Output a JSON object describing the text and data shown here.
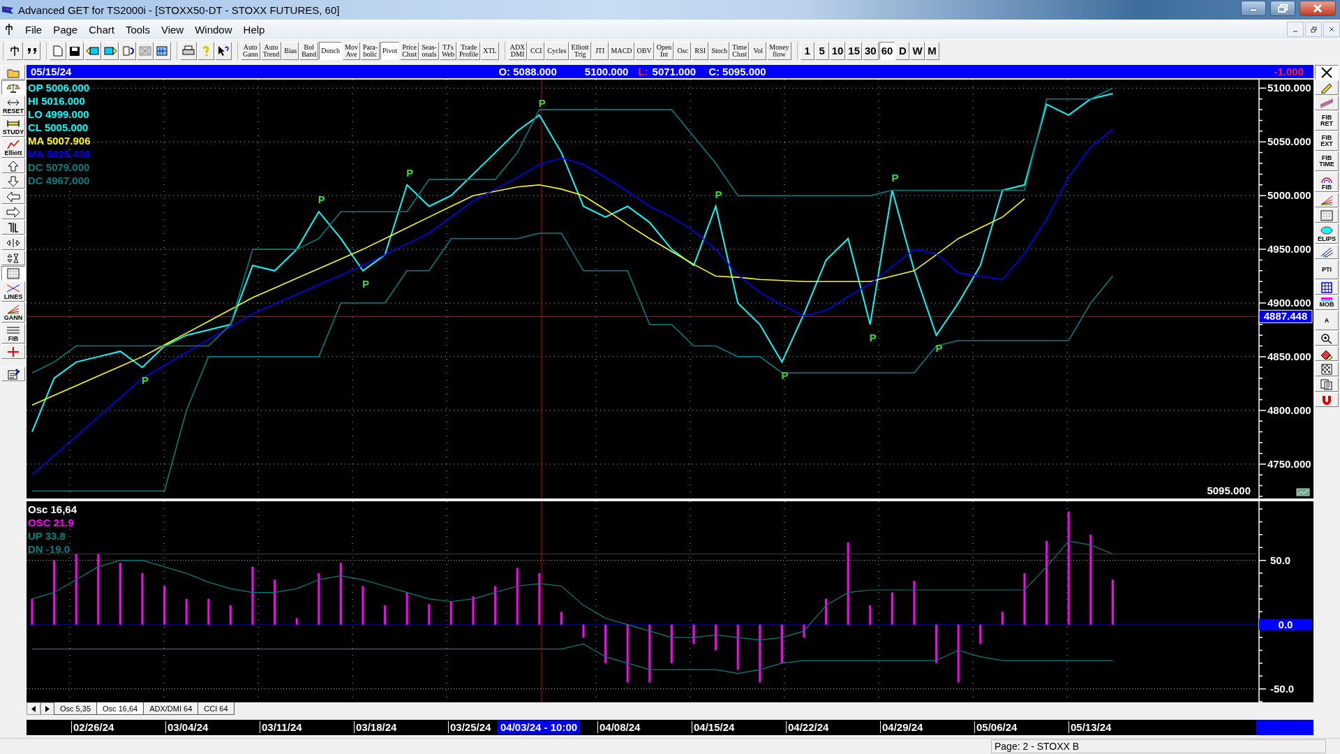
{
  "window": {
    "title": "Advanced GET for TS2000i - [STOXX50-DT - STOXX FUTURES, 60]"
  },
  "menu": [
    "File",
    "Page",
    "Chart",
    "Tools",
    "View",
    "Window",
    "Help"
  ],
  "toolbar": {
    "groups": [
      {
        "items": [
          {
            "kind": "icon",
            "selected": false
          },
          {
            "kind": "icon",
            "selected": false
          }
        ]
      },
      {
        "items": [
          {
            "kind": "icon",
            "selected": false
          },
          {
            "kind": "icon",
            "selected": false
          },
          {
            "kind": "icon",
            "selected": false
          },
          {
            "kind": "icon",
            "selected": false
          },
          {
            "kind": "icon",
            "selected": false
          },
          {
            "kind": "icon",
            "selected": false
          },
          {
            "kind": "icon",
            "selected": false
          }
        ]
      },
      {
        "items": [
          {
            "kind": "icon",
            "selected": false
          },
          {
            "kind": "icon",
            "selected": false
          },
          {
            "kind": "icon",
            "selected": false
          }
        ]
      },
      {
        "items": [
          {
            "kind": "text",
            "label": "Auto\nGann",
            "selected": false
          },
          {
            "kind": "text",
            "label": "Auto\nTrend",
            "selected": false
          },
          {
            "kind": "text",
            "label": "Bias",
            "selected": false
          },
          {
            "kind": "text",
            "label": "Bol\nBand",
            "selected": false
          },
          {
            "kind": "text",
            "label": "Donch",
            "selected": true
          },
          {
            "kind": "text",
            "label": "Mov\nAve",
            "selected": false
          },
          {
            "kind": "text",
            "label": "Para-\nbolic",
            "selected": false
          },
          {
            "kind": "text",
            "label": "Pivot",
            "selected": true
          },
          {
            "kind": "text",
            "label": "Price\nClust",
            "selected": false
          },
          {
            "kind": "text",
            "label": "Seas-\nonals",
            "selected": false
          },
          {
            "kind": "text",
            "label": "TJ's\nWeb",
            "selected": false
          },
          {
            "kind": "text",
            "label": "Trade\nProfile",
            "selected": false
          },
          {
            "kind": "text",
            "label": "XTL",
            "selected": false
          }
        ]
      },
      {
        "items": [
          {
            "kind": "text",
            "label": "ADX\nDMI",
            "selected": false
          },
          {
            "kind": "text",
            "label": "CCI",
            "selected": false
          },
          {
            "kind": "text",
            "label": "Cycles",
            "selected": false
          },
          {
            "kind": "text",
            "label": "Elliott\nTrig",
            "selected": false
          },
          {
            "kind": "text",
            "label": "JTI",
            "selected": false
          },
          {
            "kind": "text",
            "label": "MACD",
            "selected": false
          },
          {
            "kind": "text",
            "label": "OBV",
            "selected": false
          },
          {
            "kind": "text",
            "label": "Open\nInt",
            "selected": false
          },
          {
            "kind": "text",
            "label": "Osc",
            "selected": false
          },
          {
            "kind": "text",
            "label": "RSI",
            "selected": false
          },
          {
            "kind": "text",
            "label": "Stoch",
            "selected": false
          },
          {
            "kind": "text",
            "label": "Time\nClust",
            "selected": false
          },
          {
            "kind": "text",
            "label": "Vol",
            "selected": false
          },
          {
            "kind": "text",
            "label": "Money\nflow",
            "selected": false
          }
        ]
      },
      {
        "items": [
          {
            "kind": "text",
            "label": "1",
            "selected": false
          },
          {
            "kind": "text",
            "label": "5",
            "selected": false
          },
          {
            "kind": "text",
            "label": "10",
            "selected": false
          },
          {
            "kind": "text",
            "label": "15",
            "selected": false
          },
          {
            "kind": "text",
            "label": "30",
            "selected": false
          },
          {
            "kind": "text",
            "label": "60",
            "selected": true
          },
          {
            "kind": "text",
            "label": "D",
            "selected": false
          },
          {
            "kind": "text",
            "label": "W",
            "selected": false
          },
          {
            "kind": "text",
            "label": "M",
            "selected": false
          }
        ]
      }
    ]
  },
  "left_tools": [
    {
      "selected": false
    },
    {
      "selected": true
    },
    {
      "label": "RESET",
      "selected": false
    },
    {
      "label": "STUDY",
      "selected": false
    },
    {
      "label": "Elliott",
      "selected": false
    },
    {
      "selected": false
    },
    {
      "selected": false
    },
    {
      "selected": false
    },
    {
      "selected": false
    },
    {
      "selected": false
    },
    {
      "selected": false
    },
    {
      "selected": false
    },
    {
      "selected": true
    },
    {
      "label": "LINES",
      "selected": false
    },
    {
      "label": "GANN",
      "selected": false
    },
    {
      "label": "FIB",
      "selected": false
    },
    {
      "selected": false
    },
    {
      "selected": false
    }
  ],
  "right_tools": [
    {
      "selected": true
    },
    {
      "selected": false
    },
    {
      "selected": false
    },
    {
      "label": "FIB\nRET",
      "selected": false
    },
    {
      "label": "FIB\nEXT",
      "selected": false
    },
    {
      "label": "FIB\nTIME",
      "selected": false
    },
    {
      "label": "FIB",
      "selected": false
    },
    {
      "selected": false
    },
    {
      "selected": false
    },
    {
      "label": "ELIPS",
      "selected": false
    },
    {
      "selected": false
    },
    {
      "label": "PTI",
      "selected": false
    },
    {
      "selected": false
    },
    {
      "label": "MOB",
      "selected": false
    },
    {
      "label": "A",
      "selected": false
    },
    {
      "selected": false
    },
    {
      "selected": false
    },
    {
      "selected": false
    },
    {
      "selected": false
    },
    {
      "selected": false
    }
  ],
  "info_bar": {
    "date": "05/15/24",
    "open": "O: 5088.000",
    "high": "5100.000",
    "low_label": "L:",
    "low": "5071.000",
    "close": "C: 5095.000",
    "change": "-1.000"
  },
  "price_pane": {
    "legend": [
      {
        "text": "OP 5006.000",
        "color": "#00ffff"
      },
      {
        "text": "HI 5016.000",
        "color": "#00ffff"
      },
      {
        "text": "LO 4999.000",
        "color": "#00ffff"
      },
      {
        "text": "CL 5005.000",
        "color": "#00ffff"
      },
      {
        "text": "MA 5007.906",
        "color": "#ffff00"
      },
      {
        "text": "MA 5025.438",
        "color": "#0000ff"
      },
      {
        "text": "DC 5079.000",
        "color": "#008080"
      },
      {
        "text": "DC 4967.000",
        "color": "#008080"
      }
    ],
    "last_price": "5095.000",
    "chart_data": {
      "type": "line",
      "ylim": [
        4718,
        5108
      ],
      "grid": true,
      "yticks": [
        {
          "value": 5100,
          "label": "5100.000"
        },
        {
          "value": 5050,
          "label": "5050.000"
        },
        {
          "value": 5000,
          "label": "5000.000"
        },
        {
          "value": 4950,
          "label": "4950.000"
        },
        {
          "value": 4900,
          "label": "4900.000"
        },
        {
          "value": 4850,
          "label": "4850.000"
        },
        {
          "value": 4800,
          "label": "4800.000"
        },
        {
          "value": 4750,
          "label": "4750.000"
        }
      ],
      "series": [
        {
          "color": "#00ffff",
          "values": [
            4780,
            4830,
            4845,
            4850,
            4855,
            4840,
            4860,
            4870,
            4875,
            4880,
            4935,
            4930,
            4950,
            4985,
            4960,
            4930,
            4945,
            5010,
            4990,
            5000,
            5020,
            5040,
            5060,
            5075,
            5040,
            4990,
            4980,
            4990,
            4975,
            4950,
            4935,
            4990,
            4900,
            4880,
            4845,
            4890,
            4940,
            4960,
            4880,
            5005,
            4930,
            4870,
            4900,
            4935,
            5005,
            5010,
            5085,
            5075,
            5090,
            5095
          ]
        },
        {
          "color": "#ffff00",
          "values": [
            4805,
            4814,
            4823,
            4832,
            4841,
            4850,
            4861,
            4872,
            4883,
            4894,
            4905,
            4914,
            4923,
            4932,
            4941,
            4950,
            4960,
            4970,
            4980,
            4990,
            5000,
            5004,
            5008,
            5010,
            5006,
            5000,
            4987,
            4973,
            4960,
            4948,
            4936,
            4925,
            4924,
            4922,
            4921,
            4920,
            4920,
            4920,
            4920,
            4925,
            4930,
            4945,
            4960,
            4970,
            4980,
            4997,
            null,
            null,
            null,
            null
          ]
        },
        {
          "color": "#0000ff",
          "values": [
            4740,
            4758,
            4776,
            4794,
            4812,
            4830,
            4842,
            4854,
            4866,
            4878,
            4890,
            4899,
            4908,
            4917,
            4926,
            4935,
            4945,
            4955,
            4965,
            4980,
            4995,
            5006,
            5017,
            5029,
            5035,
            5029,
            5017,
            5004,
            4990,
            4980,
            4967,
            4950,
            4926,
            4910,
            4898,
            4888,
            4893,
            4906,
            4918,
            4934,
            4950,
            4946,
            4928,
            4925,
            4922,
            4946,
            4978,
            5017,
            5045,
            5062
          ]
        },
        {
          "color": "#008080",
          "values": [
            4835,
            4845,
            4860,
            4860,
            4860,
            4860,
            4860,
            4860,
            4860,
            4880,
            4950,
            4950,
            4950,
            4960,
            4985,
            4985,
            4985,
            4985,
            5015,
            5015,
            5015,
            5015,
            5040,
            5080,
            5080,
            5080,
            5080,
            5080,
            5080,
            5080,
            5055,
            5030,
            5000,
            5000,
            5000,
            5000,
            5000,
            5000,
            5000,
            5005,
            5005,
            5005,
            5005,
            5005,
            5005,
            5005,
            5090,
            5090,
            5090,
            5100
          ]
        },
        {
          "color": "#008080",
          "values": [
            4725,
            4725,
            4725,
            4725,
            4725,
            4725,
            4725,
            4800,
            4850,
            4850,
            4850,
            4850,
            4850,
            4850,
            4900,
            4900,
            4900,
            4930,
            4930,
            4960,
            4960,
            4960,
            4960,
            4965,
            4965,
            4930,
            4930,
            4930,
            4880,
            4880,
            4860,
            4860,
            4850,
            4850,
            4835,
            4835,
            4835,
            4835,
            4835,
            4835,
            4835,
            4860,
            4865,
            4865,
            4865,
            4865,
            4865,
            4865,
            4900,
            4925
          ]
        }
      ],
      "ref_lines": [
        {
          "axis": "y",
          "value": 4887.448,
          "label": "4887.448",
          "color": "#c00000"
        }
      ],
      "annotations": [
        "P",
        "P",
        "P",
        "P",
        "P",
        "P",
        "P",
        "P",
        "P",
        "P"
      ]
    }
  },
  "osc_pane": {
    "legend": [
      {
        "text": "Osc 16,64",
        "color": "#ffffff"
      },
      {
        "text": "OSC 21.9",
        "color": "#ff00ff"
      },
      {
        "text": "UP 33.8",
        "color": "#008080"
      },
      {
        "text": "DN -19.0",
        "color": "#008080"
      }
    ],
    "chart_data": {
      "type": "bar",
      "ylim": [
        -60.5,
        96
      ],
      "grid": true,
      "yticks": [
        {
          "value": 50,
          "label": "50.0"
        },
        {
          "value": -50,
          "label": "-50.0"
        }
      ],
      "series": [
        {
          "color": "#ff00ff",
          "values": [
            20,
            50,
            55,
            55,
            48,
            40,
            30,
            20,
            20,
            15,
            45,
            35,
            5,
            40,
            48,
            30,
            15,
            25,
            16,
            18,
            22,
            30,
            44,
            40,
            10,
            -10,
            -30,
            -45,
            -45,
            -30,
            -15,
            -20,
            -35,
            -45,
            -30,
            -10,
            20,
            64,
            15,
            25,
            34,
            -30,
            -45,
            -15,
            10,
            40,
            65,
            88,
            70,
            35
          ]
        },
        {
          "type": "line",
          "color": "#008080",
          "values": [
            20,
            25,
            35,
            45,
            50,
            50,
            45,
            40,
            33,
            28,
            25,
            25,
            28,
            35,
            38,
            35,
            30,
            25,
            20,
            18,
            20,
            25,
            30,
            32,
            30,
            15,
            5,
            0,
            -5,
            -10,
            -10,
            -8,
            -10,
            -12,
            -10,
            -5,
            15,
            25,
            27,
            27,
            27,
            27,
            27,
            27,
            27,
            27,
            45,
            65,
            62,
            55
          ]
        },
        {
          "type": "line",
          "color": "#008080",
          "values": [
            -19,
            -19,
            -19,
            -19,
            -19,
            -19,
            -19,
            -19,
            -19,
            -19,
            -19,
            -19,
            -19,
            -19,
            -19,
            -19,
            -19,
            -19,
            -19,
            -19,
            -19,
            -19,
            -19,
            -19,
            -19,
            -15,
            -25,
            -30,
            -35,
            -35,
            -35,
            -35,
            -38,
            -35,
            -30,
            -28,
            -28,
            -28,
            -28,
            -28,
            -28,
            -28,
            -20,
            -25,
            -28,
            -28,
            -28,
            -28,
            -28,
            -28
          ]
        }
      ],
      "ref_lines": [
        {
          "axis": "y",
          "value": 55,
          "color": "#c00000"
        },
        {
          "axis": "y",
          "value": 0,
          "label": "0.0",
          "color": "#000080"
        }
      ]
    }
  },
  "tabs": [
    {
      "label": "Osc 5,35",
      "selected": false
    },
    {
      "label": "Osc 16,64",
      "selected": true
    },
    {
      "label": "ADX/DMI 64",
      "selected": false
    },
    {
      "label": "CCI 64",
      "selected": false
    }
  ],
  "date_axis": [
    {
      "kind": "date",
      "text": "02/26/24"
    },
    {
      "kind": "date",
      "text": "03/04/24"
    },
    {
      "kind": "date",
      "text": "03/11/24"
    },
    {
      "kind": "date",
      "text": "03/18/24"
    },
    {
      "kind": "date",
      "text": "03/25/24"
    },
    {
      "kind": "cursor",
      "text": "04/03/24 - 10:00"
    },
    {
      "kind": "date",
      "text": "04/08/24"
    },
    {
      "kind": "date",
      "text": "04/15/24"
    },
    {
      "kind": "date",
      "text": "04/22/24"
    },
    {
      "kind": "date",
      "text": "04/29/24"
    },
    {
      "kind": "date",
      "text": "05/06/24"
    },
    {
      "kind": "date",
      "text": "05/13/24"
    }
  ],
  "status_bar": {
    "text": "Page: 2 - STOXX B"
  }
}
